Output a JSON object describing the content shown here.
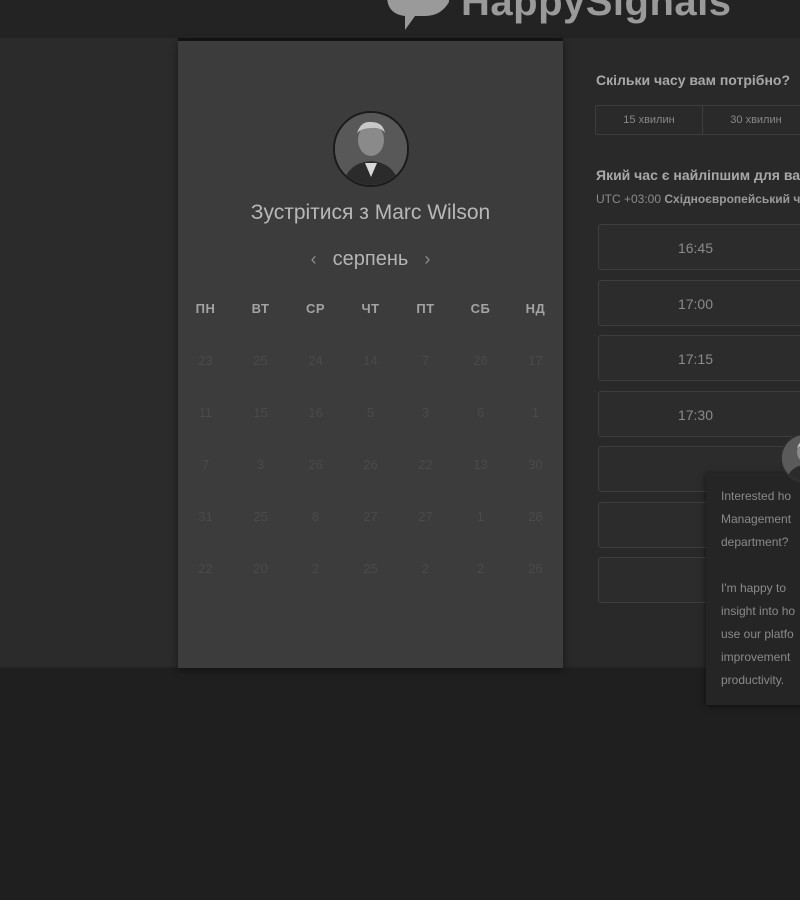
{
  "header": {
    "brand_name": "HappySignals"
  },
  "calendar": {
    "title": "Зустрітися з Marc Wilson",
    "month": "серпень",
    "prev_icon": "‹",
    "next_icon": "›",
    "weekdays": [
      "ПН",
      "ВТ",
      "СР",
      "ЧТ",
      "ПТ",
      "СБ",
      "НД"
    ],
    "days": [
      "23",
      "25",
      "24",
      "14",
      "7",
      "26",
      "17",
      "11",
      "15",
      "16",
      "5",
      "3",
      "6",
      "1",
      "7",
      "3",
      "26",
      "26",
      "22",
      "13",
      "30",
      "31",
      "25",
      "8",
      "27",
      "27",
      "1",
      "28",
      "22",
      "20",
      "2",
      "25",
      "2",
      "2",
      "26"
    ]
  },
  "booking": {
    "duration_question": "Скільки часу вам потрібно?",
    "durations": [
      "15 хвилин",
      "30 хвилин"
    ],
    "time_question": "Який час є найліпшим для вас?",
    "timezone_offset": "UTC +03:00",
    "timezone_name": "Східноєвропейський час",
    "slots": [
      "16:45",
      "17:00",
      "17:15",
      "17:30",
      "",
      "",
      ""
    ]
  },
  "chat": {
    "message": "Interested ho\nManagement\ndepartment?\n\nI'm happy to\ninsight into ho\nuse our platfo\nimprovement\nproductivity."
  },
  "colors": {
    "background": "#1f1f1f",
    "card": "#3c3c3c",
    "panel": "#292929"
  }
}
